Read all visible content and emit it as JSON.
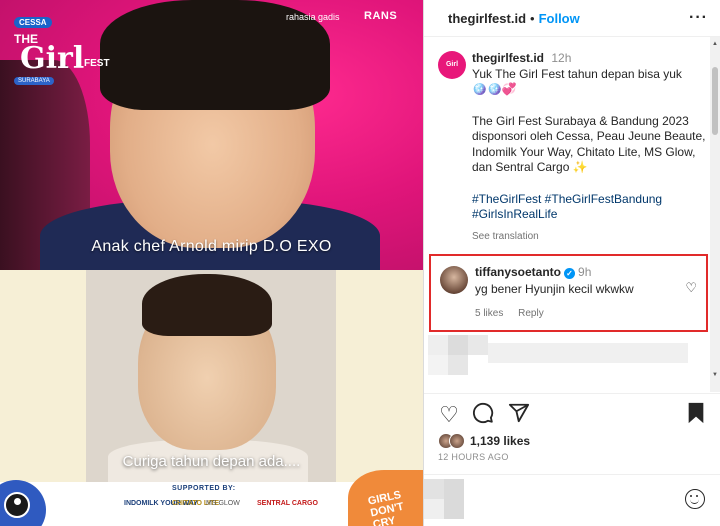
{
  "media": {
    "logo": {
      "brand": "CESSA",
      "line1": "THE",
      "line2": "Girl",
      "line3": "FEST",
      "city": "SURABAYA"
    },
    "partners": [
      "rahasia gadis",
      "RANS"
    ],
    "caption_top": "Anak chef Arnold mirip D.O EXO",
    "caption_bottom": "Curiga tahun depan ada....",
    "supported_by": "SUPPORTED BY:",
    "sponsors": [
      "INDOMILK YOUR WAY",
      "CHITATO LITE",
      "MS GLOW",
      "SENTRAL CARGO"
    ],
    "sticker_text": "GIRLS DON'T CRY"
  },
  "header": {
    "username": "thegirlfest.id",
    "separator": "•",
    "follow": "Follow",
    "more": "···"
  },
  "post": {
    "avatar_text": "Girl",
    "username": "thegirlfest.id",
    "time": "12h",
    "line1": "Yuk The Girl Fest tahun depan bisa yuk",
    "emojis": "🪩🪩💞",
    "body": "The Girl Fest Surabaya & Bandung 2023 disponsori oleh Cessa, Peau Jeune Beaute, Indomilk Your Way, Chitato Lite, MS Glow, dan Sentral Cargo ✨",
    "tags": "#TheGirlFest #TheGirlFestBandung #GirlsInRealLife",
    "see_translation": "See translation"
  },
  "comment": {
    "username": "tiffanysoetanto",
    "verified": "✓",
    "time": "9h",
    "text": "yg bener Hyunjin kecil wkwkw",
    "likes": "5 likes",
    "reply": "Reply"
  },
  "actions": {
    "likes": "1,139 likes",
    "date": "12 HOURS AGO"
  },
  "comment_input": {
    "placeholder": ""
  },
  "icons": [
    "heart-icon",
    "comment-icon",
    "share-icon",
    "bookmark-icon",
    "emoji-icon",
    "more-icon",
    "verified-icon"
  ],
  "colors": {
    "accent": "#0095f6",
    "highlight": "#e12a2a",
    "brand_pink": "#e8177a"
  }
}
